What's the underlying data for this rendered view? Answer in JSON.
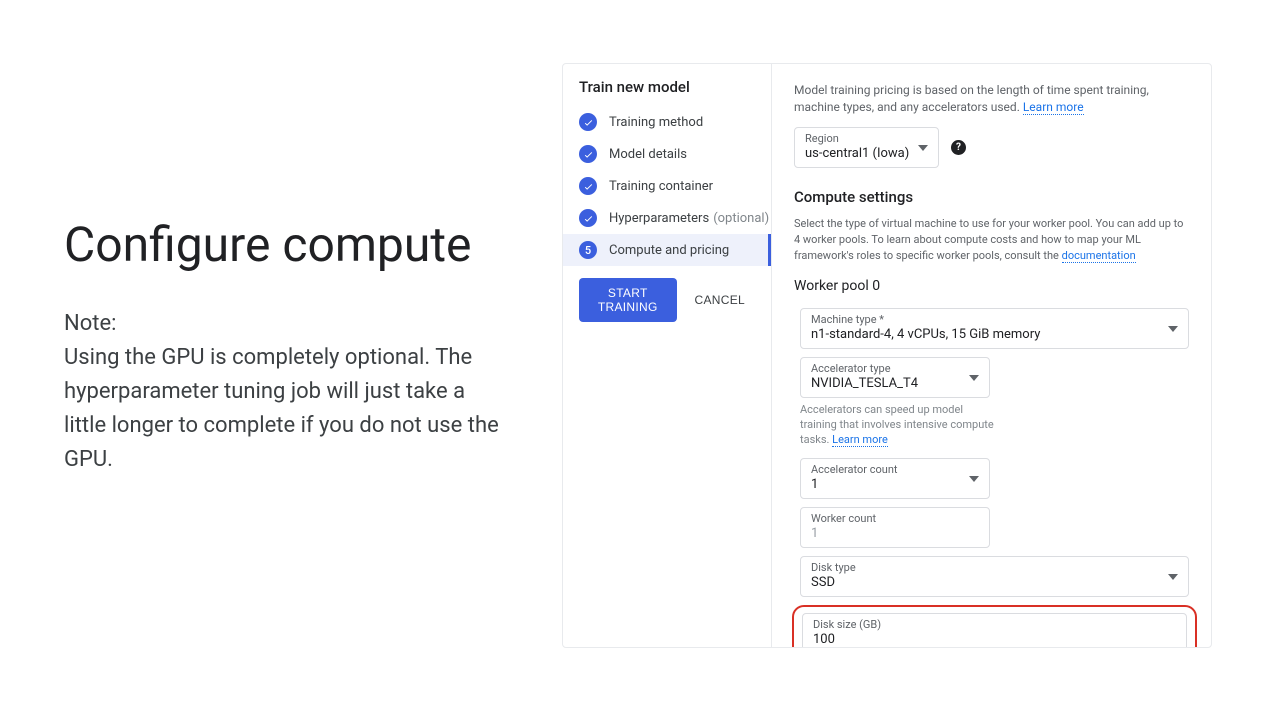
{
  "leftPanel": {
    "title": "Configure compute",
    "noteLabel": "Note:",
    "noteBody": "Using the GPU is completely optional. The hyperparameter tuning job will just take a little longer to complete if you do not use the GPU."
  },
  "sidebar": {
    "title": "Train new model",
    "steps": [
      {
        "label": "Training method",
        "done": true
      },
      {
        "label": "Model details",
        "done": true
      },
      {
        "label": "Training container",
        "done": true
      },
      {
        "label": "Hyperparameters",
        "optional": "(optional)",
        "done": true
      },
      {
        "label": "Compute and pricing",
        "active": true,
        "number": "5"
      }
    ],
    "startBtn": "START TRAINING",
    "cancelBtn": "CANCEL"
  },
  "content": {
    "pricingDesc": "Model training pricing is based on the length of time spent training, machine types, and any accelerators used.",
    "learnMore": "Learn more",
    "region": {
      "label": "Region",
      "value": "us-central1 (Iowa)"
    },
    "computeHeading": "Compute settings",
    "computeDesc": "Select the type of virtual machine to use for your worker pool. You can add up to 4 worker pools. To learn about compute costs and how to map your ML framework's roles to specific worker pools, consult the",
    "docLink": "documentation",
    "workerPoolTitle": "Worker pool 0",
    "machineType": {
      "label": "Machine type *",
      "value": "n1-standard-4, 4 vCPUs, 15 GiB memory"
    },
    "accelType": {
      "label": "Accelerator type",
      "value": "NVIDIA_TESLA_T4"
    },
    "accelHint": "Accelerators can speed up model training that involves intensive compute tasks.",
    "accelCount": {
      "label": "Accelerator count",
      "value": "1"
    },
    "workerCount": {
      "label": "Worker count",
      "value": "1"
    },
    "diskType": {
      "label": "Disk type",
      "value": "SSD"
    },
    "diskSize": {
      "label": "Disk size (GB)",
      "value": "100"
    }
  }
}
